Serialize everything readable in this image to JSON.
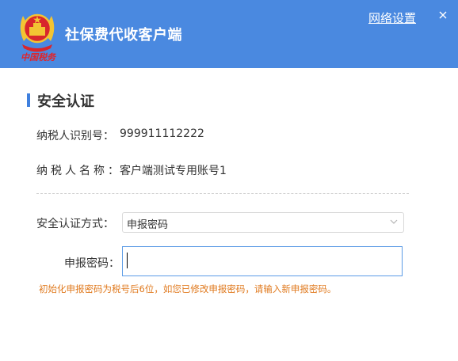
{
  "header": {
    "title": "社保费代收客户端",
    "brand_script": "中国税务",
    "network_settings_label": "网络设置",
    "close_glyph": "×",
    "background_color": "#4a89e0"
  },
  "section": {
    "title": "安全认证",
    "accent_color": "#3f80de"
  },
  "info": {
    "taxpayer_id_label": "纳税人识别号：",
    "taxpayer_id_value": "999911112222",
    "taxpayer_name_label": "纳税人名称：",
    "taxpayer_name_value": "客户端测试专用账号1"
  },
  "form": {
    "auth_method_label": "安全认证方式：",
    "auth_method_value": "申报密码",
    "password_label": "申报密码：",
    "password_value": "",
    "hint": "初始化申报密码为税号后6位，如您已修改申报密码，请输入新申报密码。",
    "hint_color": "#e07a1f"
  }
}
